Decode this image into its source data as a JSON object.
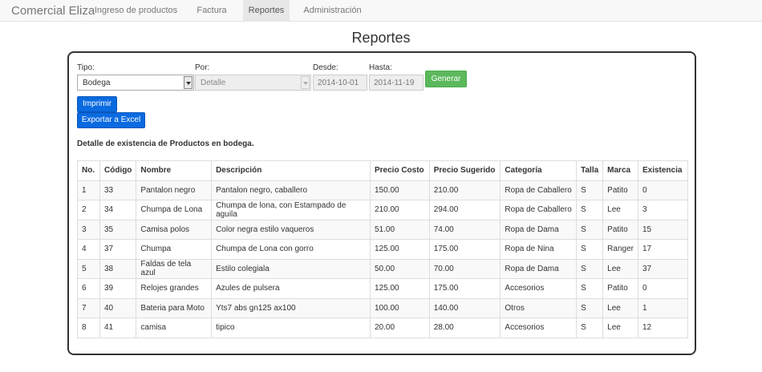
{
  "navbar": {
    "brand": "Comercial Eliza",
    "links": [
      {
        "label": "Ingreso de productos"
      },
      {
        "label": "Factura"
      },
      {
        "label": "Reportes",
        "active": true
      },
      {
        "label": "Administración"
      }
    ]
  },
  "page": {
    "title": "Reportes"
  },
  "form": {
    "tipo_label": "Tipo:",
    "tipo_value": "Bodega",
    "por_label": "Por:",
    "por_value": "Detalle",
    "desde_label": "Desde:",
    "desde_value": "2014-10-01",
    "hasta_label": "Hasta:",
    "hasta_value": "2014-11-19",
    "generar_label": "Generar",
    "imprimir_label": "Imprimir",
    "exportar_label": "Exportar a Excel"
  },
  "report": {
    "subtitle": "Detalle de existencia de Productos en bodega.",
    "columns": [
      "No.",
      "Código",
      "Nombre",
      "Descripción",
      "Precio Costo",
      "Precio Sugerido",
      "Categoría",
      "Talla",
      "Marca",
      "Existencia"
    ],
    "rows": [
      [
        "1",
        "33",
        "Pantalon negro",
        "Pantalon negro, caballero",
        "150.00",
        "210.00",
        "Ropa de Caballero",
        "S",
        "Patito",
        "0"
      ],
      [
        "2",
        "34",
        "Chumpa de Lona",
        "Chumpa de lona, con Estampado de aguila",
        "210.00",
        "294.00",
        "Ropa de Caballero",
        "S",
        "Lee",
        "3"
      ],
      [
        "3",
        "35",
        "Camisa polos",
        "Color negra estilo vaqueros",
        "51.00",
        "74.00",
        "Ropa de Dama",
        "S",
        "Patito",
        "15"
      ],
      [
        "4",
        "37",
        "Chumpa",
        "Chumpa de Lona con gorro",
        "125.00",
        "175.00",
        "Ropa de Nina",
        "S",
        "Ranger",
        "17"
      ],
      [
        "5",
        "38",
        "Faldas de tela azul",
        "Estilo colegiala",
        "50.00",
        "70.00",
        "Ropa de Dama",
        "S",
        "Lee",
        "37"
      ],
      [
        "6",
        "39",
        "Relojes grandes",
        "Azules de pulsera",
        "125.00",
        "175.00",
        "Accesorios",
        "S",
        "Patito",
        "0"
      ],
      [
        "7",
        "40",
        "Bateria para Moto",
        "Yts7 abs gn125 ax100",
        "100.00",
        "140.00",
        "Otros",
        "S",
        "Lee",
        "1"
      ],
      [
        "8",
        "41",
        "camisa",
        "tipico",
        "20.00",
        "28.00",
        "Accesorios",
        "S",
        "Lee",
        "12"
      ]
    ]
  }
}
